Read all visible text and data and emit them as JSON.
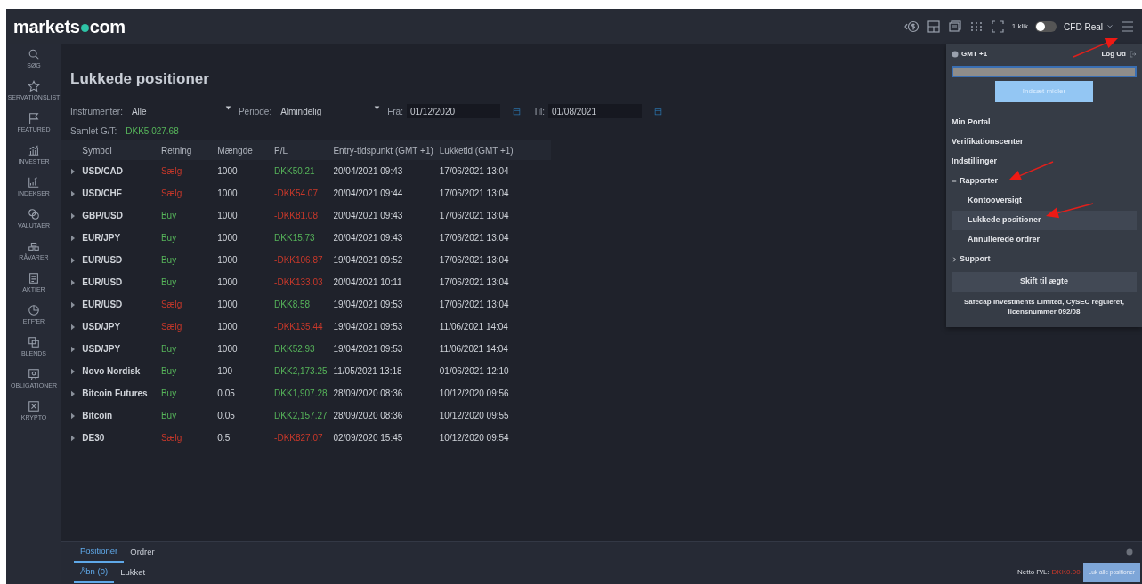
{
  "brand": {
    "left": "markets",
    "right": "com"
  },
  "topbar": {
    "one_click_label": "1 klik",
    "one_click_on": false,
    "account": "CFD Real"
  },
  "sidebar": {
    "items": [
      {
        "label": "SØG"
      },
      {
        "label": "SERVATIONSLIST"
      },
      {
        "label": "FEATURED"
      },
      {
        "label": "INVESTER"
      },
      {
        "label": "INDEKSER"
      },
      {
        "label": "VALUTAER"
      },
      {
        "label": "RÅVARER"
      },
      {
        "label": "AKTIER"
      },
      {
        "label": "ETF'ER"
      },
      {
        "label": "BLENDS"
      },
      {
        "label": "OBLIGATIONER"
      },
      {
        "label": "KRYPTO"
      }
    ]
  },
  "page": {
    "title": "Lukkede positioner"
  },
  "filters": {
    "instrument_label": "Instrumenter:",
    "instrument_value": "Alle",
    "period_label": "Periode:",
    "period_value": "Almindelig",
    "from_label": "Fra:",
    "from_value": "01/12/2020",
    "to_label": "Til:",
    "to_value": "01/08/2021"
  },
  "total": {
    "label": "Samlet G/T:",
    "value": "DKK5,027.68"
  },
  "table": {
    "columns": [
      "Symbol",
      "Retning",
      "Mængde",
      "P/L",
      "Entry-tidspunkt (GMT +1)",
      "Lukketid (GMT +1)"
    ],
    "rows": [
      {
        "symbol": "USD/CAD",
        "direction": "Sælg",
        "sell": true,
        "amount": "1000",
        "pl": "DKK50.21",
        "profit": true,
        "entry": "20/04/2021 09:43",
        "closed": "17/06/2021 13:04"
      },
      {
        "symbol": "USD/CHF",
        "direction": "Sælg",
        "sell": true,
        "amount": "1000",
        "pl": "-DKK54.07",
        "profit": false,
        "entry": "20/04/2021 09:44",
        "closed": "17/06/2021 13:04"
      },
      {
        "symbol": "GBP/USD",
        "direction": "Buy",
        "sell": false,
        "amount": "1000",
        "pl": "-DKK81.08",
        "profit": false,
        "entry": "20/04/2021 09:43",
        "closed": "17/06/2021 13:04"
      },
      {
        "symbol": "EUR/JPY",
        "direction": "Buy",
        "sell": false,
        "amount": "1000",
        "pl": "DKK15.73",
        "profit": true,
        "entry": "20/04/2021 09:43",
        "closed": "17/06/2021 13:04"
      },
      {
        "symbol": "EUR/USD",
        "direction": "Buy",
        "sell": false,
        "amount": "1000",
        "pl": "-DKK106.87",
        "profit": false,
        "entry": "19/04/2021 09:52",
        "closed": "17/06/2021 13:04"
      },
      {
        "symbol": "EUR/USD",
        "direction": "Buy",
        "sell": false,
        "amount": "1000",
        "pl": "-DKK133.03",
        "profit": false,
        "entry": "20/04/2021 10:11",
        "closed": "17/06/2021 13:04"
      },
      {
        "symbol": "EUR/USD",
        "direction": "Sælg",
        "sell": true,
        "amount": "1000",
        "pl": "DKK8.58",
        "profit": true,
        "entry": "19/04/2021 09:53",
        "closed": "17/06/2021 13:04"
      },
      {
        "symbol": "USD/JPY",
        "direction": "Sælg",
        "sell": true,
        "amount": "1000",
        "pl": "-DKK135.44",
        "profit": false,
        "entry": "19/04/2021 09:53",
        "closed": "11/06/2021 14:04"
      },
      {
        "symbol": "USD/JPY",
        "direction": "Buy",
        "sell": false,
        "amount": "1000",
        "pl": "DKK52.93",
        "profit": true,
        "entry": "19/04/2021 09:53",
        "closed": "11/06/2021 14:04"
      },
      {
        "symbol": "Novo Nordisk",
        "direction": "Buy",
        "sell": false,
        "amount": "100",
        "pl": "DKK2,173.25",
        "profit": true,
        "entry": "11/05/2021 13:18",
        "closed": "01/06/2021 12:10"
      },
      {
        "symbol": "Bitcoin Futures",
        "direction": "Buy",
        "sell": false,
        "amount": "0.05",
        "pl": "DKK1,907.28",
        "profit": true,
        "entry": "28/09/2020 08:36",
        "closed": "10/12/2020 09:56"
      },
      {
        "symbol": "Bitcoin",
        "direction": "Buy",
        "sell": false,
        "amount": "0.05",
        "pl": "DKK2,157.27",
        "profit": true,
        "entry": "28/09/2020 08:36",
        "closed": "10/12/2020 09:55"
      },
      {
        "symbol": "DE30",
        "direction": "Sælg",
        "sell": true,
        "amount": "0.5",
        "pl": "-DKK827.07",
        "profit": false,
        "entry": "02/09/2020 15:45",
        "closed": "10/12/2020 09:54"
      }
    ]
  },
  "bottom_panel": {
    "tabs": [
      {
        "label": "Positioner",
        "selected": true
      },
      {
        "label": "Ordrer",
        "selected": false
      }
    ],
    "subtabs": [
      {
        "label": "Åbn (0)",
        "selected": true
      },
      {
        "label": "Lukket",
        "selected": false
      }
    ],
    "net_label": "Netto P/L:",
    "net_value": "DKK0.00",
    "net_profit": false,
    "close_all": "Luk alle positioner"
  },
  "menu": {
    "timezone": "GMT +1",
    "logout": "Log Ud",
    "deposit": "Indsæt midler",
    "items": [
      {
        "label": "Min Portal"
      },
      {
        "label": "Verifikationscenter"
      },
      {
        "label": "Indstillinger"
      },
      {
        "label": "Rapporter",
        "expanded": true,
        "children": [
          {
            "label": "Kontooversigt",
            "selected": false
          },
          {
            "label": "Lukkede positioner",
            "selected": true
          },
          {
            "label": "Annullerede ordrer",
            "selected": false
          }
        ]
      },
      {
        "label": "Support",
        "expanded": false
      }
    ],
    "switch_button": "Skift til ægte",
    "disclaimer": "Safecap Investments Limited, CySEC reguleret, licensnummer 092/08"
  }
}
